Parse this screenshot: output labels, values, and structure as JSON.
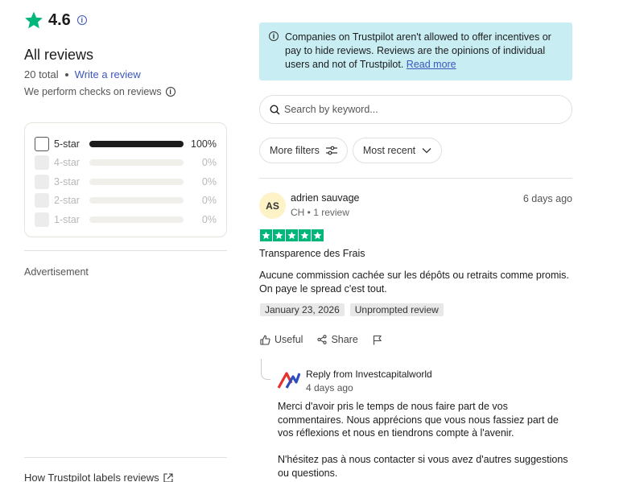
{
  "rating": {
    "value": "4.6",
    "star_color": "#00b67a"
  },
  "summary": {
    "heading": "All reviews",
    "total": "20 total",
    "write_review": "Write a review",
    "checks": "We perform checks on reviews"
  },
  "distribution": [
    {
      "label": "5-star",
      "percent": "100%",
      "fill": 1.0,
      "enabled": true
    },
    {
      "label": "4-star",
      "percent": "0%",
      "fill": 0,
      "enabled": false
    },
    {
      "label": "3-star",
      "percent": "0%",
      "fill": 0,
      "enabled": false
    },
    {
      "label": "2-star",
      "percent": "0%",
      "fill": 0,
      "enabled": false
    },
    {
      "label": "1-star",
      "percent": "0%",
      "fill": 0,
      "enabled": false
    }
  ],
  "advertisement": "Advertisement",
  "labels_link": "How Trustpilot labels reviews",
  "notice": {
    "text": "Companies on Trustpilot aren't allowed to offer incentives or pay to hide reviews. Reviews are the opinions of individual users and not of Trustpilot.",
    "link": "Read more"
  },
  "search": {
    "placeholder": "Search by keyword..."
  },
  "filters": {
    "more": "More filters",
    "sort": "Most recent"
  },
  "review": {
    "initials": "AS",
    "author": "adrien sauvage",
    "meta": "CH • 1 review",
    "date": "6 days ago",
    "stars": 5,
    "title": "Transparence des Frais",
    "body": "Aucune commission cachée sur les dépôts ou retraits comme promis. On paye le spread c'est tout.",
    "experience_date": "January 23, 2026",
    "tag": "Unprompted review",
    "useful": "Useful",
    "share": "Share"
  },
  "reply": {
    "from": "Reply from Investcapitalworld",
    "date": "4 days ago",
    "paragraph1": "Merci d'avoir pris le temps de nous faire part de vos commentaires. Nous apprécions que vous nous fassiez part de vos réflexions et nous en tiendrons compte à l'avenir.",
    "paragraph2": "N'hésitez pas à nous contacter si vous avez d'autres suggestions ou questions."
  }
}
